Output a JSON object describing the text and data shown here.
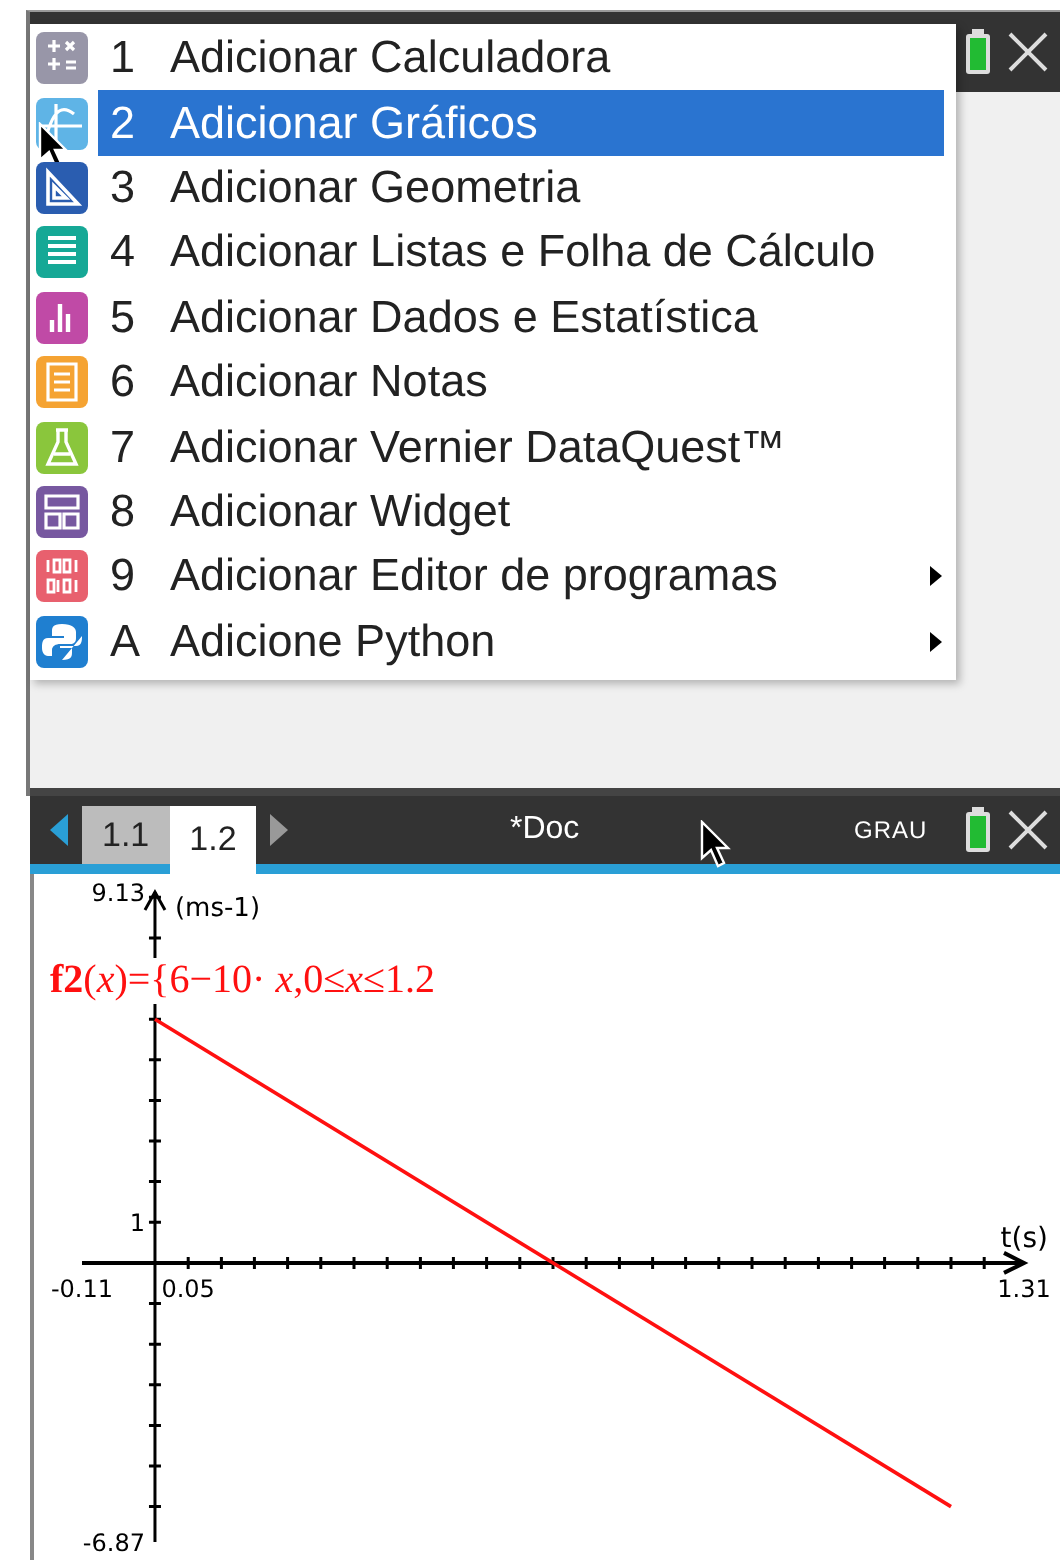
{
  "menu": {
    "items": [
      {
        "key": "1",
        "label": "Adicionar Calculadora",
        "kind": "calculator",
        "selected": false,
        "submenu": false
      },
      {
        "key": "2",
        "label": "Adicionar Gráficos",
        "kind": "graphs",
        "selected": true,
        "submenu": false
      },
      {
        "key": "3",
        "label": "Adicionar Geometria",
        "kind": "geometry",
        "selected": false,
        "submenu": false
      },
      {
        "key": "4",
        "label": "Adicionar Listas e Folha de Cálculo",
        "kind": "lists",
        "selected": false,
        "submenu": false
      },
      {
        "key": "5",
        "label": "Adicionar Dados e Estatística",
        "kind": "data",
        "selected": false,
        "submenu": false
      },
      {
        "key": "6",
        "label": "Adicionar Notas",
        "kind": "notes",
        "selected": false,
        "submenu": false
      },
      {
        "key": "7",
        "label": "Adicionar Vernier DataQuest™",
        "kind": "vernier",
        "selected": false,
        "submenu": false
      },
      {
        "key": "8",
        "label": "Adicionar Widget",
        "kind": "widget",
        "selected": false,
        "submenu": false
      },
      {
        "key": "9",
        "label": "Adicionar Editor de programas",
        "kind": "program",
        "selected": false,
        "submenu": true
      },
      {
        "key": "A",
        "label": "Adicione Python",
        "kind": "python",
        "selected": false,
        "submenu": true
      }
    ]
  },
  "document": {
    "tabs": [
      {
        "label": "1.1",
        "selected": false
      },
      {
        "label": "1.2",
        "selected": true
      }
    ],
    "title": "*Doc",
    "angle_mode": "GRAU"
  },
  "graph": {
    "function_label": "**f2**(*x*)={6−10· *x*,0≤*x*≤1.2",
    "chart_data": {
      "type": "line",
      "xlabel": "t(s)",
      "ylabel": "(ms-1)",
      "xlim": [
        -0.11,
        1.31
      ],
      "ylim": [
        -6.87,
        9.13
      ],
      "xticks": [
        {
          "value": -0.11,
          "label": "-0.11"
        },
        {
          "value": 0.05,
          "label": "0.05"
        },
        {
          "value": 1.31,
          "label": "1.31"
        }
      ],
      "yticks": [
        {
          "value": 9.13,
          "label": "9.13"
        },
        {
          "value": 1,
          "label": "1"
        },
        {
          "value": -6.87,
          "label": "-6.87"
        }
      ],
      "x": [
        0,
        1.2
      ],
      "series": [
        {
          "color": "#ff1010",
          "values": [
            6,
            -6
          ]
        }
      ]
    }
  }
}
